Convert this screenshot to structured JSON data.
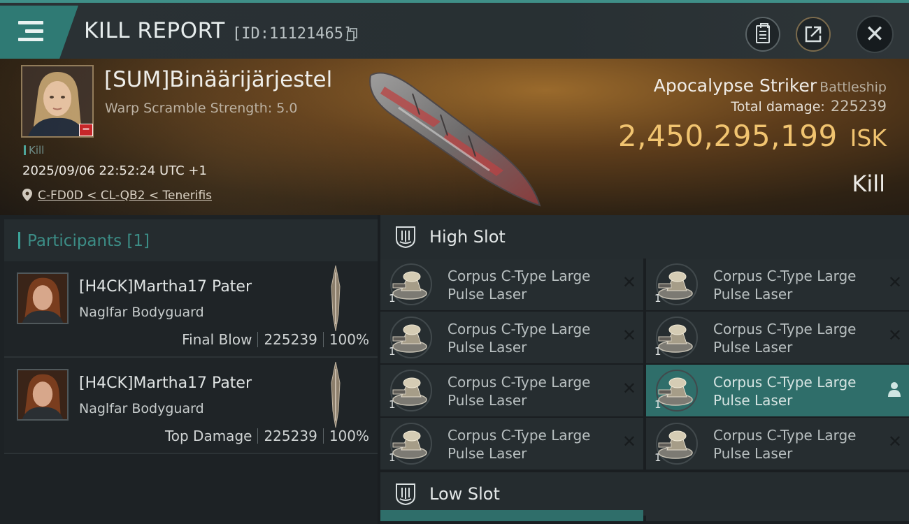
{
  "header": {
    "title": "KILL REPORT",
    "report_id": "[ID:11121465]",
    "icons": [
      "menu-icon",
      "copy-icon",
      "clipboard-icon",
      "external-link-icon",
      "close-icon"
    ]
  },
  "victim": {
    "name": "[SUM]Binäärijärjestel",
    "warp_scramble": "Warp Scramble Strength: 5.0",
    "tag": "Kill",
    "timestamp": "2025/09/06 22:52:24 UTC +1",
    "location": "C-FD0D < CL-QB2 < Tenerifis",
    "ship_name": "Apocalypse Striker",
    "ship_class": "Battleship",
    "total_damage_label": "Total damage:",
    "total_damage": "225239",
    "isk_value": "2,450,295,199",
    "isk_unit": "ISK",
    "result": "Kill"
  },
  "participants": {
    "title": "Participants [1]",
    "items": [
      {
        "name": "[H4CK]Martha17 Pater",
        "ship": "Naglfar Bodyguard",
        "role": "Final Blow",
        "damage": "225239",
        "percent": "100%"
      },
      {
        "name": "[H4CK]Martha17 Pater",
        "ship": "Naglfar Bodyguard",
        "role": "Top Damage",
        "damage": "225239",
        "percent": "100%"
      }
    ]
  },
  "high_slot": {
    "title": "High Slot",
    "modules": [
      {
        "name": "Corpus C-Type Large Pulse Laser",
        "qty": "1",
        "status": "destroyed"
      },
      {
        "name": "Corpus C-Type Large Pulse Laser",
        "qty": "1",
        "status": "destroyed"
      },
      {
        "name": "Corpus C-Type Large Pulse Laser",
        "qty": "1",
        "status": "destroyed"
      },
      {
        "name": "Corpus C-Type Large Pulse Laser",
        "qty": "1",
        "status": "destroyed"
      },
      {
        "name": "Corpus C-Type Large Pulse Laser",
        "qty": "1",
        "status": "destroyed"
      },
      {
        "name": "Corpus C-Type Large Pulse Laser",
        "qty": "1",
        "status": "dropped",
        "highlighted": true
      },
      {
        "name": "Corpus C-Type Large Pulse Laser",
        "qty": "1",
        "status": "destroyed"
      },
      {
        "name": "Corpus C-Type Large Pulse Laser",
        "qty": "1",
        "status": "destroyed"
      }
    ]
  },
  "low_slot": {
    "title": "Low Slot"
  },
  "colors": {
    "accent": "#3ca59b",
    "isk": "#f1c470",
    "highlight": "#2f6e6a"
  }
}
